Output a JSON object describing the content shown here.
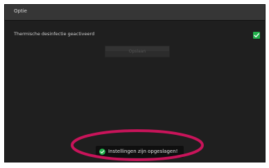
{
  "header": {
    "title": "Optie"
  },
  "setting": {
    "label": "Thermische desinfectie geactiveerd",
    "checked": true,
    "checkbox_icon": "checkmark-icon"
  },
  "actions": {
    "save_label": "Opslaan"
  },
  "toast": {
    "message": "Instellingen zijn opgeslagen!",
    "icon": "check-circle-icon"
  },
  "colors": {
    "panel": "#1f1f1f",
    "header": "#363636",
    "accent_green": "#22b14c",
    "highlight_ellipse": "#c8145a"
  }
}
